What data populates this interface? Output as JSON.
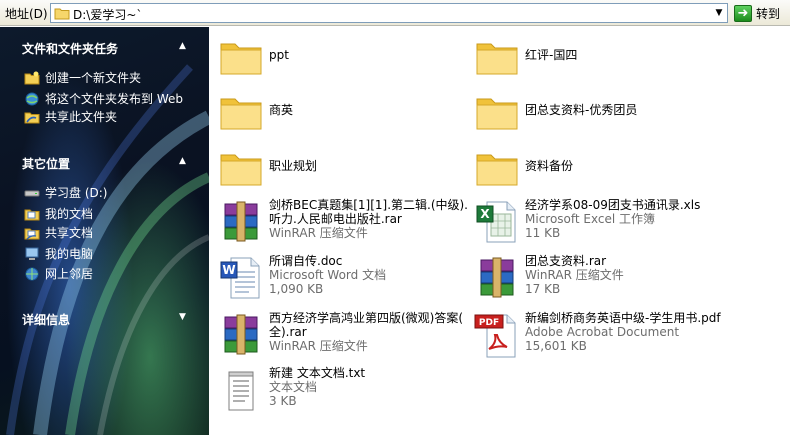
{
  "address": {
    "label": "地址(D)",
    "path": "D:\\爱学习~`",
    "goto_label": "转到"
  },
  "taskpane": {
    "sections": [
      {
        "title": "文件和文件夹任务",
        "items": [
          {
            "label": "创建一个新文件夹",
            "icon": "new-folder-icon"
          },
          {
            "label": "将这个文件夹发布到 Web",
            "icon": "publish-web-icon"
          },
          {
            "label": "共享此文件夹",
            "icon": "share-folder-icon"
          }
        ]
      },
      {
        "title": "其它位置",
        "items": [
          {
            "label": "学习盘 (D:)",
            "icon": "drive-icon"
          },
          {
            "label": "我的文档",
            "icon": "my-documents-icon"
          },
          {
            "label": "共享文档",
            "icon": "shared-documents-icon"
          },
          {
            "label": "我的电脑",
            "icon": "my-computer-icon"
          },
          {
            "label": "网上邻居",
            "icon": "network-icon"
          }
        ]
      },
      {
        "title": "详细信息",
        "items": []
      }
    ]
  },
  "files": [
    {
      "name": "ppt",
      "type": "folder"
    },
    {
      "name": "红评-国四",
      "type": "folder"
    },
    {
      "name": "商英",
      "type": "folder"
    },
    {
      "name": "团总支资料-优秀团员",
      "type": "folder"
    },
    {
      "name": "职业规划",
      "type": "folder"
    },
    {
      "name": "资料备份",
      "type": "folder"
    },
    {
      "name_line1": "剑桥BEC真题集[1][1].第二辑.(中级).",
      "name_line2": "听力.人民邮电出版社.rar",
      "kind": "WinRAR 压缩文件",
      "type": "rar"
    },
    {
      "name": "经济学系08-09团支书通讯录.xls",
      "kind": "Microsoft Excel 工作簿",
      "size": "11 KB",
      "type": "xls"
    },
    {
      "name": "所谓自传.doc",
      "kind": "Microsoft Word 文档",
      "size": "1,090 KB",
      "type": "doc"
    },
    {
      "name": "团总支资料.rar",
      "kind": "WinRAR 压缩文件",
      "size": "17 KB",
      "type": "rar"
    },
    {
      "name_line1": "西方经济学高鸿业第四版(微观)答案(",
      "name_line2": "全).rar",
      "kind": "WinRAR 压缩文件",
      "type": "rar"
    },
    {
      "name": "新编剑桥商务英语中级-学生用书.pdf",
      "kind": "Adobe Acrobat Document",
      "size": "15,601 KB",
      "type": "pdf"
    },
    {
      "name": "新建 文本文档.txt",
      "kind": "文本文档",
      "size": "3 KB",
      "type": "txt"
    }
  ]
}
